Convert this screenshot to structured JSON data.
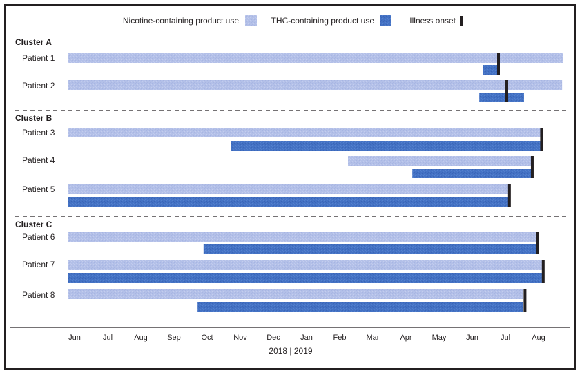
{
  "chart_data": {
    "type": "timeline",
    "title": "",
    "legend": {
      "placement": "top-center",
      "items": [
        {
          "key": "nicotine",
          "label": "Nicotine-containing product use",
          "color": "#b3c0e8"
        },
        {
          "key": "thc",
          "label": "THC-containing product use",
          "color": "#4472c4"
        },
        {
          "key": "onset",
          "label": "Illness onset",
          "color": "#231f20"
        }
      ]
    },
    "x_axis": {
      "unit": "months since June 2018",
      "range": [
        0,
        15
      ],
      "ticks": [
        {
          "m": 0,
          "label": "Jun"
        },
        {
          "m": 1,
          "label": "Jul"
        },
        {
          "m": 2,
          "label": "Aug"
        },
        {
          "m": 3,
          "label": "Sep"
        },
        {
          "m": 4,
          "label": "Oct"
        },
        {
          "m": 5,
          "label": "Nov"
        },
        {
          "m": 6,
          "label": "Dec"
        },
        {
          "m": 7,
          "label": "Jan"
        },
        {
          "m": 8,
          "label": "Feb"
        },
        {
          "m": 9,
          "label": "Mar"
        },
        {
          "m": 10,
          "label": "Apr"
        },
        {
          "m": 11,
          "label": "May"
        },
        {
          "m": 12,
          "label": "Jun"
        },
        {
          "m": 13,
          "label": "Jul"
        },
        {
          "m": 14,
          "label": "Aug"
        }
      ],
      "year_label": "2018 | 2019"
    },
    "clusters": [
      {
        "label": "Cluster A",
        "patients": [
          {
            "label": "Patient 1",
            "nicotine": [
              0,
              14.94
            ],
            "thc": [
              12.54,
              13.0
            ],
            "onset": 13.0
          },
          {
            "label": "Patient 2",
            "nicotine": [
              0,
              14.92
            ],
            "thc": [
              12.42,
              13.77
            ],
            "onset": 13.25
          }
        ]
      },
      {
        "label": "Cluster B",
        "patients": [
          {
            "label": "Patient 3",
            "nicotine": [
              0,
              14.27
            ],
            "thc": [
              4.92,
              14.27
            ],
            "onset": 14.3
          },
          {
            "label": "Patient 4",
            "nicotine": [
              8.46,
              14.0
            ],
            "thc": [
              10.4,
              14.0
            ],
            "onset": 14.02
          },
          {
            "label": "Patient 5",
            "nicotine": [
              0,
              13.31
            ],
            "thc": [
              0,
              13.31
            ],
            "onset": 13.33
          }
        ]
      },
      {
        "label": "Cluster C",
        "patients": [
          {
            "label": "Patient 6",
            "nicotine": [
              0,
              14.13
            ],
            "thc": [
              4.1,
              14.13
            ],
            "onset": 14.17
          },
          {
            "label": "Patient 7",
            "nicotine": [
              0,
              14.31
            ],
            "thc": [
              0,
              14.31
            ],
            "onset": 14.35
          },
          {
            "label": "Patient 8",
            "nicotine": [
              0,
              13.75
            ],
            "thc": [
              3.92,
              13.75
            ],
            "onset": 13.8
          }
        ]
      }
    ]
  }
}
